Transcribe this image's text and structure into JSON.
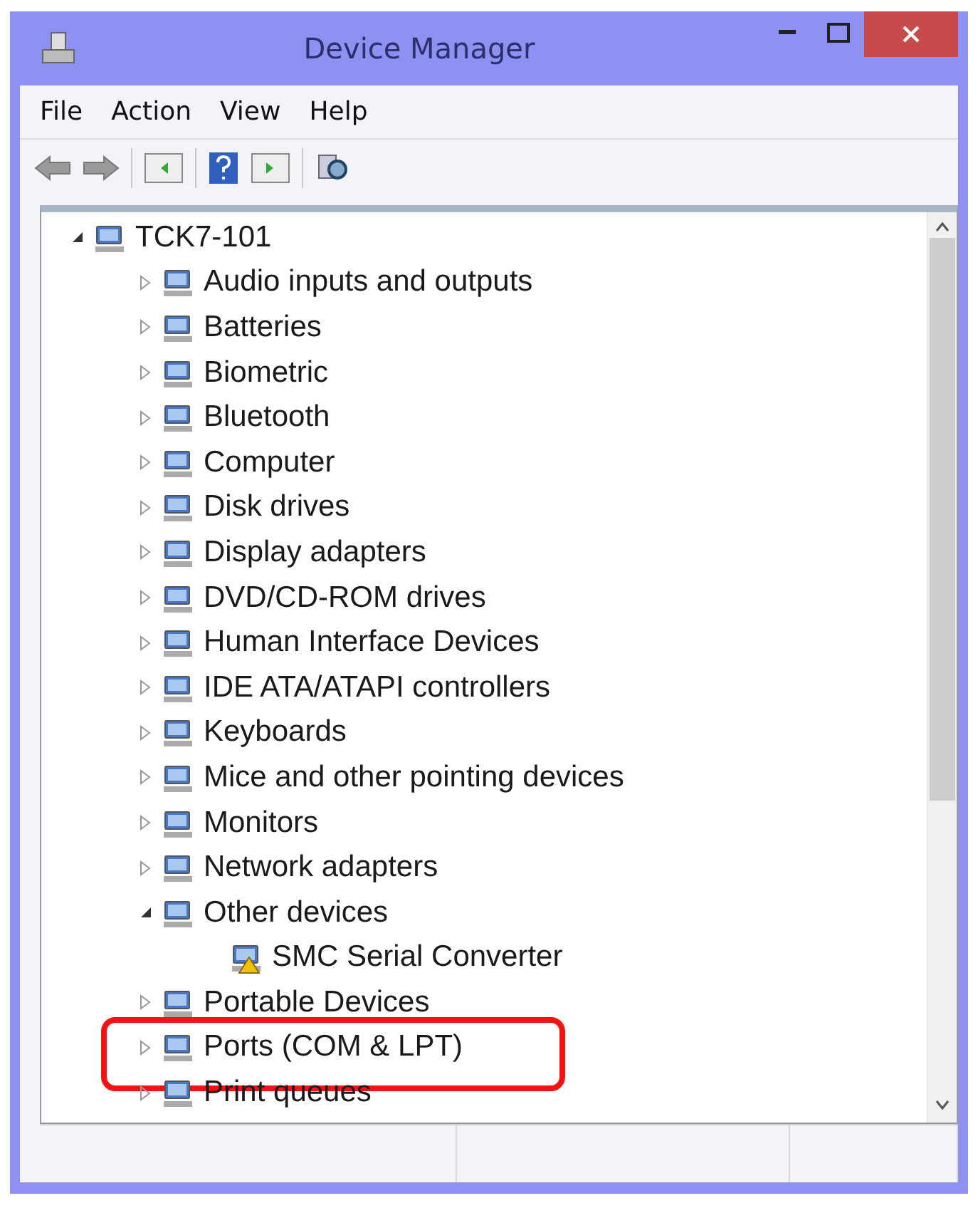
{
  "window": {
    "title": "Device Manager"
  },
  "menu": [
    "File",
    "Action",
    "View",
    "Help"
  ],
  "tree": [
    {
      "label": "TCK7-101",
      "expanded": true,
      "highlighted": false,
      "children": [
        {
          "label": "Audio inputs and outputs",
          "expanded": false,
          "highlighted": false
        },
        {
          "label": "Batteries",
          "expanded": false,
          "highlighted": false
        },
        {
          "label": "Biometric",
          "expanded": false,
          "highlighted": false
        },
        {
          "label": "Bluetooth",
          "expanded": false,
          "highlighted": false
        },
        {
          "label": "Computer",
          "expanded": false,
          "highlighted": false
        },
        {
          "label": "Disk drives",
          "expanded": false,
          "highlighted": false
        },
        {
          "label": "Display adapters",
          "expanded": false,
          "highlighted": false
        },
        {
          "label": "DVD/CD-ROM drives",
          "expanded": false,
          "highlighted": false
        },
        {
          "label": "Human Interface Devices",
          "expanded": false,
          "highlighted": false
        },
        {
          "label": "IDE ATA/ATAPI controllers",
          "expanded": false,
          "highlighted": false
        },
        {
          "label": "Keyboards",
          "expanded": false,
          "highlighted": false
        },
        {
          "label": "Mice and other pointing devices",
          "expanded": false,
          "highlighted": false
        },
        {
          "label": "Monitors",
          "expanded": false,
          "highlighted": false
        },
        {
          "label": "Network adapters",
          "expanded": false,
          "highlighted": false
        },
        {
          "label": "Other devices",
          "expanded": true,
          "highlighted": false,
          "children": [
            {
              "label": "SMC Serial Converter",
              "highlighted": false
            }
          ]
        },
        {
          "label": "Portable Devices",
          "expanded": false,
          "highlighted": false
        },
        {
          "label": "Ports (COM & LPT)",
          "expanded": false,
          "highlighted": true
        },
        {
          "label": "Print queues",
          "expanded": false,
          "highlighted": false
        }
      ]
    }
  ]
}
